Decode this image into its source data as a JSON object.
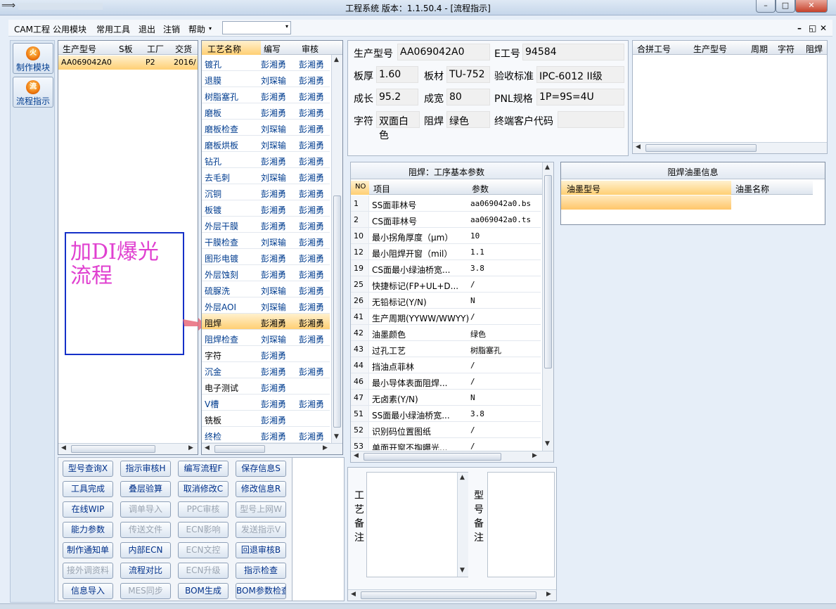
{
  "window": {
    "title": "工程系统   版本：1.1.50.4 - [流程指示]",
    "controls": [
      "–",
      "□",
      "✕"
    ]
  },
  "menu": {
    "items": [
      "CAM工程",
      "公用模块",
      "常用工具",
      "退出",
      "注销",
      "帮助"
    ],
    "combo_value": "",
    "mdi_controls": [
      "–",
      "◱",
      "✕"
    ]
  },
  "leftnav": {
    "items": [
      {
        "label": "制作模块",
        "icon": "fire-icon"
      },
      {
        "label": "流程指示",
        "icon": "flow-icon"
      }
    ]
  },
  "order_list": {
    "headers": [
      "生产型号",
      "S板",
      "工厂",
      "交货日"
    ],
    "rows": [
      [
        "AA069042A0",
        "",
        "P2",
        "2016/"
      ]
    ]
  },
  "process_list": {
    "headers": [
      "工艺名称",
      "编写",
      "审核"
    ],
    "selected_index": 17,
    "rows": [
      [
        "镀孔",
        "彭湘勇",
        "彭湘勇"
      ],
      [
        "退膜",
        "刘琛输",
        "彭湘勇"
      ],
      [
        "树脂塞孔",
        "彭湘勇",
        "彭湘勇"
      ],
      [
        "磨板",
        "彭湘勇",
        "彭湘勇"
      ],
      [
        "磨板检查",
        "刘琛输",
        "彭湘勇"
      ],
      [
        "磨板烘板",
        "刘琛输",
        "彭湘勇"
      ],
      [
        "钻孔",
        "彭湘勇",
        "彭湘勇"
      ],
      [
        "去毛刺",
        "刘琛输",
        "彭湘勇"
      ],
      [
        "沉铜",
        "彭湘勇",
        "彭湘勇"
      ],
      [
        "板镀",
        "彭湘勇",
        "彭湘勇"
      ],
      [
        "外层干膜",
        "彭湘勇",
        "彭湘勇"
      ],
      [
        "干膜检查",
        "刘琛输",
        "彭湘勇"
      ],
      [
        "图形电镀",
        "彭湘勇",
        "彭湘勇"
      ],
      [
        "外层蚀刻",
        "彭湘勇",
        "彭湘勇"
      ],
      [
        "硫脲洗",
        "刘琛输",
        "彭湘勇"
      ],
      [
        "外层AOI",
        "刘琛输",
        "彭湘勇"
      ],
      [
        "阻焊",
        "彭湘勇",
        "彭湘勇"
      ],
      [
        "阻焊检查",
        "刘琛输",
        "彭湘勇"
      ],
      [
        "字符",
        "彭湘勇",
        ""
      ],
      [
        "沉金",
        "彭湘勇",
        "彭湘勇"
      ],
      [
        "电子测试",
        "彭湘勇",
        ""
      ],
      [
        "V槽",
        "彭湘勇",
        "彭湘勇"
      ],
      [
        "铣板",
        "彭湘勇",
        ""
      ],
      [
        "终检",
        "彭湘勇",
        "彭湘勇"
      ]
    ]
  },
  "annotation": {
    "text": "加DI爆光流程"
  },
  "info": {
    "model_label": "生产型号",
    "model": "AA069042A0",
    "e_label": "E工号",
    "e_no": "94584",
    "thick_label": "板厚",
    "thick": "1.60",
    "mat_label": "板材",
    "mat": "TU-752",
    "std_label": "验收标准",
    "std": "IPC-6012 II级",
    "len_label": "成长",
    "len": "95.2",
    "wid_label": "成宽",
    "wid": "80",
    "pnl_label": "PNL规格",
    "pnl": "1P=9S=4U",
    "char_label": "字符",
    "char": "双面白色",
    "mask_label": "阻焊",
    "mask": "绿色",
    "cust_label": "终端客户代码",
    "cust": ""
  },
  "merge_table": {
    "headers": [
      "合拼工号",
      "生产型号",
      "周期",
      "字符",
      "阻焊"
    ]
  },
  "params": {
    "title": "阻焊：工序基本参数",
    "headers": [
      "NO",
      "项目",
      "参数"
    ],
    "rows": [
      [
        "1",
        "SS面菲林号",
        "aa069042a0.bs"
      ],
      [
        "2",
        "CS面菲林号",
        "aa069042a0.ts"
      ],
      [
        "10",
        "最小拐角厚度（μm）",
        "10"
      ],
      [
        "12",
        "最小阻焊开窗（mil）",
        "1.1"
      ],
      [
        "19",
        "CS面最小绿油桥宽...",
        "3.8"
      ],
      [
        "25",
        "快捷标记(FP+UL+D...",
        "/"
      ],
      [
        "26",
        "无铅标记(Y/N)",
        "N"
      ],
      [
        "41",
        "生产周期(YYWW/WWYY)",
        "/"
      ],
      [
        "42",
        "油墨颜色",
        "绿色"
      ],
      [
        "43",
        "过孔工艺",
        "树脂塞孔"
      ],
      [
        "44",
        "挡油点菲林",
        "/"
      ],
      [
        "46",
        "最小导体表面阻焊...",
        "/"
      ],
      [
        "47",
        "无卤素(Y/N)",
        "N"
      ],
      [
        "51",
        "SS面最小绿油桥宽...",
        "3.8"
      ],
      [
        "52",
        "识别码位置图纸",
        "/"
      ],
      [
        "53",
        "单面开窗不掏曝光...",
        "/"
      ]
    ]
  },
  "ink": {
    "title": "阻焊油墨信息",
    "headers": [
      "油墨型号",
      "油墨名称"
    ]
  },
  "remarks": {
    "process_label": "工艺备注",
    "model_label": "型号备注"
  },
  "buttons": [
    {
      "label": "型号查询X",
      "enabled": true
    },
    {
      "label": "指示审核H",
      "enabled": true
    },
    {
      "label": "编写流程F",
      "enabled": true
    },
    {
      "label": "保存信息S",
      "enabled": true
    },
    {
      "label": "工具完成",
      "enabled": true
    },
    {
      "label": "叠层验算",
      "enabled": true
    },
    {
      "label": "取消修改C",
      "enabled": true
    },
    {
      "label": "修改信息R",
      "enabled": true
    },
    {
      "label": "在线WIP",
      "enabled": true
    },
    {
      "label": "调单导入",
      "enabled": false
    },
    {
      "label": "PPC审核",
      "enabled": false
    },
    {
      "label": "型号上网W",
      "enabled": false
    },
    {
      "label": "能力参数",
      "enabled": true
    },
    {
      "label": "传送文件",
      "enabled": false
    },
    {
      "label": "ECN影响",
      "enabled": false
    },
    {
      "label": "发送指示V",
      "enabled": false
    },
    {
      "label": "制作通知单",
      "enabled": true
    },
    {
      "label": "内部ECN",
      "enabled": true
    },
    {
      "label": "ECN文控",
      "enabled": false
    },
    {
      "label": "回退审核B",
      "enabled": true
    },
    {
      "label": "接外调资料",
      "enabled": false
    },
    {
      "label": "流程对比",
      "enabled": true
    },
    {
      "label": "ECN升级",
      "enabled": false
    },
    {
      "label": "指示检查",
      "enabled": true
    },
    {
      "label": "信息导入",
      "enabled": true
    },
    {
      "label": "MES同步",
      "enabled": false
    },
    {
      "label": "BOM生成",
      "enabled": true
    },
    {
      "label": "BOM参数检查",
      "enabled": true
    }
  ],
  "colors": {
    "accent": "#ffcf73",
    "link": "#003c8f",
    "annotation_border": "#1530c8",
    "annotation_text": "#e040d0"
  }
}
